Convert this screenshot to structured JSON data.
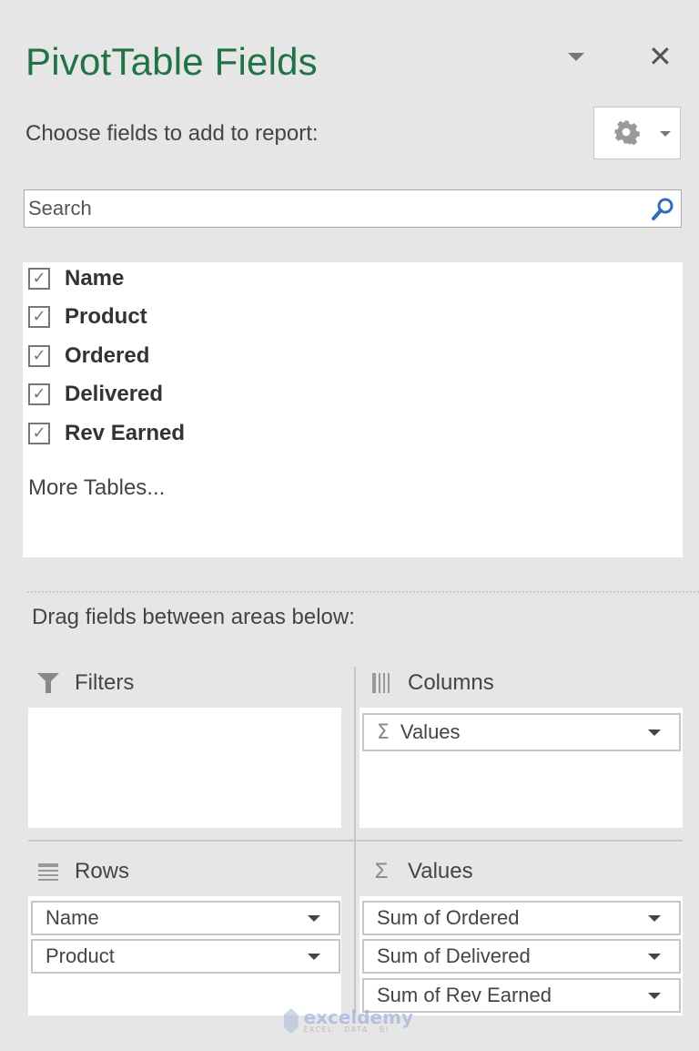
{
  "panel": {
    "title": "PivotTable Fields",
    "close_glyph": "✕",
    "choose_label": "Choose fields to add to report:",
    "settings_icon": "gear-icon",
    "gear_glyph": "✿"
  },
  "search": {
    "value": "",
    "placeholder": "Search"
  },
  "fields": [
    {
      "label": "Name",
      "checked": true
    },
    {
      "label": "Product",
      "checked": true
    },
    {
      "label": "Ordered",
      "checked": true
    },
    {
      "label": "Delivered",
      "checked": true
    },
    {
      "label": "Rev Earned",
      "checked": true
    }
  ],
  "check_glyph": "✓",
  "more_tables": "More Tables...",
  "drag_label": "Drag fields between areas below:",
  "areas": {
    "filters": {
      "label": "Filters",
      "icon": "filter-icon",
      "items": []
    },
    "columns": {
      "label": "Columns",
      "icon": "columns-icon",
      "items": [
        {
          "label": "Values",
          "sigma": "Σ"
        }
      ]
    },
    "rows": {
      "label": "Rows",
      "icon": "rows-icon",
      "items": [
        {
          "label": "Name"
        },
        {
          "label": "Product"
        }
      ]
    },
    "values": {
      "label": "Values",
      "icon": "sigma-icon",
      "sigma": "Σ",
      "items": [
        {
          "label": "Sum of Ordered"
        },
        {
          "label": "Sum of Delivered"
        },
        {
          "label": "Sum of Rev Earned"
        }
      ]
    }
  },
  "watermark": {
    "brand": "exceldemy",
    "tagline": "EXCEL · DATA · BI"
  },
  "colors": {
    "title_green": "#217346",
    "search_icon_blue": "#2e6eb5"
  }
}
